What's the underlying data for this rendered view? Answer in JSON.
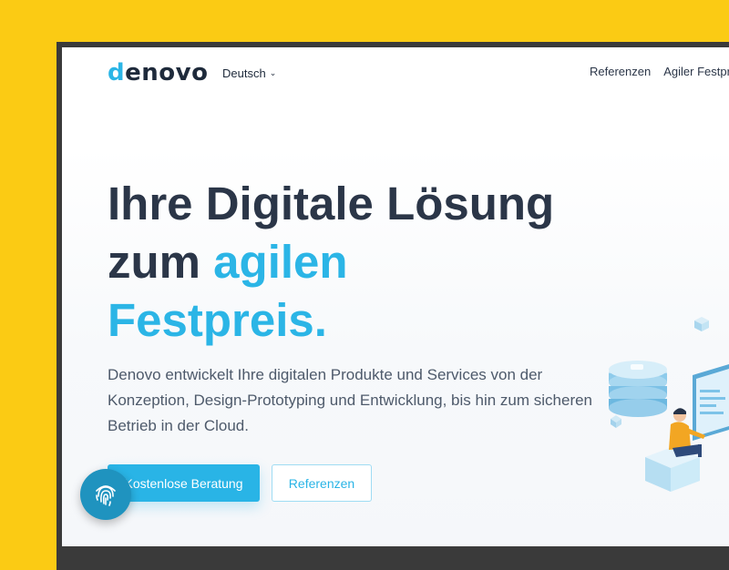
{
  "brand": {
    "logo": "denovo"
  },
  "nav": {
    "language": "Deutsch",
    "links": [
      "Referenzen",
      "Agiler Festpr"
    ]
  },
  "hero": {
    "headline_part1": "Ihre Digitale Lösung",
    "headline_part2": "zum ",
    "headline_accent1": "agilen",
    "headline_accent2": "Festpreis.",
    "description": "Denovo entwickelt Ihre digitalen Produkte und Services von der Konzeption, Design-Prototyping und Entwicklung, bis hin zum sicheren Betrieb in der Cloud.",
    "cta_primary": "Kostenlose Beratung",
    "cta_secondary": "Referenzen"
  },
  "icons": {
    "fingerprint": "fingerprint-icon",
    "chevron": "chevron-down-icon"
  },
  "colors": {
    "background": "#FBCB14",
    "accent": "#2BB5E6",
    "text_dark": "#2B3648",
    "fab": "#1F93BF"
  }
}
